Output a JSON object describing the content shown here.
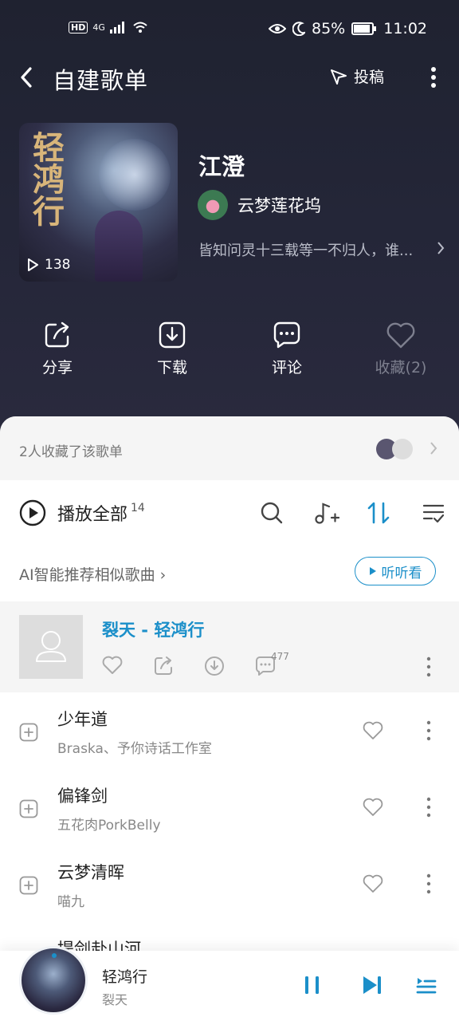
{
  "status": {
    "network": "4G",
    "battery": "85%",
    "time": "11:02",
    "hd": "HD"
  },
  "header": {
    "title": "自建歌单",
    "submit_label": "投稿"
  },
  "playlist": {
    "name": "江澄",
    "play_count": "138",
    "creator": "云梦莲花坞",
    "description": "皆知问灵十三载等一不归人，谁...",
    "cover_calligraphy": "轻鸿行"
  },
  "actions": [
    {
      "label": "分享",
      "icon": "share-icon"
    },
    {
      "label": "下载",
      "icon": "download-icon"
    },
    {
      "label": "评论",
      "icon": "comment-icon"
    },
    {
      "label": "收藏(2)",
      "icon": "heart-icon"
    }
  ],
  "favorites": {
    "text": "2人收藏了该歌单"
  },
  "toolbar": {
    "play_all": "播放全部",
    "count": "14"
  },
  "ai": {
    "text": "AI智能推荐相似歌曲 ›",
    "listen_label": "听听看"
  },
  "now_playing": {
    "title": "裂天 - 轻鸿行",
    "comment_count": "477"
  },
  "songs": [
    {
      "name": "少年道",
      "artist": "Braska、予你诗话工作室"
    },
    {
      "name": "偏锋剑",
      "artist": "五花肉PorkBelly"
    },
    {
      "name": "云梦清晖",
      "artist": "喵九"
    },
    {
      "name": "提剑赴山河",
      "artist": ""
    }
  ],
  "player": {
    "title": "轻鸿行",
    "artist": "裂天"
  },
  "colors": {
    "accent": "#1b8fc9",
    "hero_bg": "#23263a"
  }
}
